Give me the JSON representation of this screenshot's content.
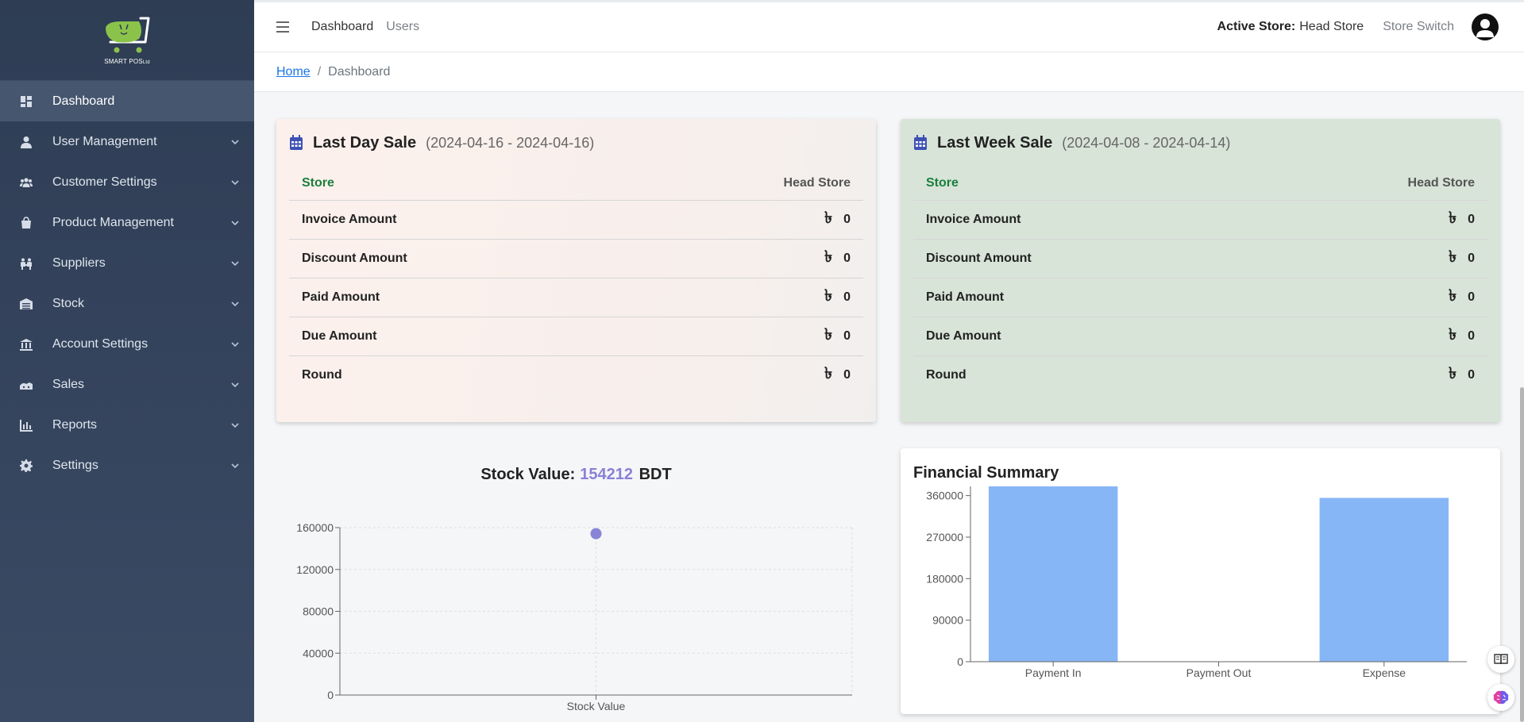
{
  "brand": {
    "logo_text": "SMART POS",
    "logo_suffix": "Ltd",
    "accent": "#8bc34a"
  },
  "sidebar": {
    "items": [
      {
        "label": "Dashboard",
        "icon": "dashboard-icon",
        "active": true,
        "has_submenu": false
      },
      {
        "label": "User Management",
        "icon": "user-icon",
        "has_submenu": true
      },
      {
        "label": "Customer Settings",
        "icon": "users-group-icon",
        "has_submenu": true
      },
      {
        "label": "Product Management",
        "icon": "bag-icon",
        "has_submenu": true
      },
      {
        "label": "Suppliers",
        "icon": "supplier-icon",
        "has_submenu": true
      },
      {
        "label": "Stock",
        "icon": "warehouse-icon",
        "has_submenu": true
      },
      {
        "label": "Account Settings",
        "icon": "bank-icon",
        "has_submenu": true
      },
      {
        "label": "Sales",
        "icon": "sales-icon",
        "has_submenu": true
      },
      {
        "label": "Reports",
        "icon": "bar-chart-icon",
        "has_submenu": true
      },
      {
        "label": "Settings",
        "icon": "gear-icon",
        "has_submenu": true
      }
    ]
  },
  "topbar": {
    "links": [
      "Dashboard",
      "Users"
    ],
    "active_store_label": "Active Store:",
    "active_store_value": "Head Store",
    "store_switch": "Store Switch"
  },
  "breadcrumb": {
    "home": "Home",
    "separator": "/",
    "current": "Dashboard"
  },
  "last_day": {
    "title": "Last Day Sale",
    "range": "(2024-04-16 - 2024-04-16)",
    "store_header": "Store",
    "store_name": "Head Store",
    "currency": "৳",
    "rows": [
      {
        "label": "Invoice Amount",
        "value": "0"
      },
      {
        "label": "Discount Amount",
        "value": "0"
      },
      {
        "label": "Paid Amount",
        "value": "0"
      },
      {
        "label": "Due Amount",
        "value": "0"
      },
      {
        "label": "Round",
        "value": "0"
      }
    ]
  },
  "last_week": {
    "title": "Last Week Sale",
    "range": "(2024-04-08 - 2024-04-14)",
    "store_header": "Store",
    "store_name": "Head Store",
    "currency": "৳",
    "rows": [
      {
        "label": "Invoice Amount",
        "value": "0"
      },
      {
        "label": "Discount Amount",
        "value": "0"
      },
      {
        "label": "Paid Amount",
        "value": "0"
      },
      {
        "label": "Due Amount",
        "value": "0"
      },
      {
        "label": "Round",
        "value": "0"
      }
    ]
  },
  "stock": {
    "label": "Stock Value:",
    "value": "154212",
    "unit": "BDT"
  },
  "financial": {
    "title": "Financial Summary"
  },
  "chart_data": [
    {
      "type": "scatter",
      "title": "Stock Value: 154212 BDT",
      "categories": [
        "Stock Value"
      ],
      "values": [
        154212
      ],
      "yticks": [
        0,
        40000,
        80000,
        120000,
        160000
      ],
      "ylim": [
        0,
        160000
      ],
      "grid": true,
      "color": "#8884d8"
    },
    {
      "type": "bar",
      "title": "Financial Summary",
      "categories": [
        "Payment In",
        "Payment Out",
        "Expense"
      ],
      "values": [
        380000,
        0,
        355000
      ],
      "yticks": [
        0,
        90000,
        180000,
        270000,
        360000
      ],
      "ylim": [
        0,
        380000
      ],
      "grid": false,
      "color": "#86b6f6"
    }
  ]
}
